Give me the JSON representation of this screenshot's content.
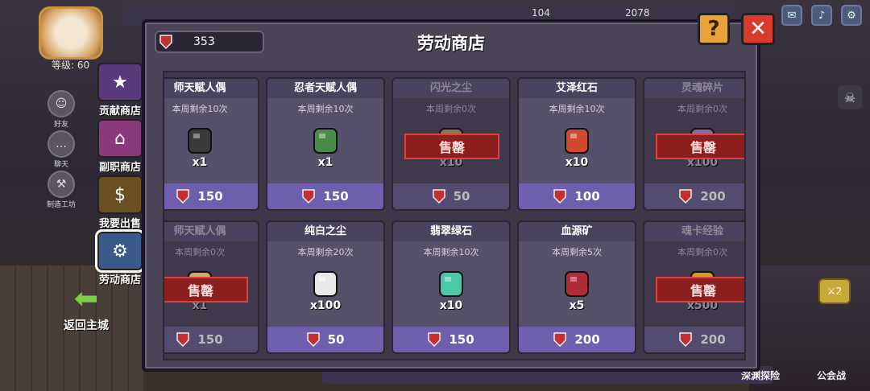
{
  "shop": {
    "title": "劳动商店",
    "currency": "353",
    "help_label": "?",
    "close_label": "✕"
  },
  "player": {
    "level": "等级: 60"
  },
  "top_resources": {
    "res1": "104",
    "res2": "2078"
  },
  "side_menu": [
    {
      "label": "好友",
      "icon": "friend-icon"
    },
    {
      "label": "聊天",
      "icon": "chat-icon"
    },
    {
      "label": "制造工坊",
      "icon": "workshop-icon"
    }
  ],
  "shop_tabs": [
    {
      "label": "贡献商店",
      "color": "#5a3a7a",
      "glyph": "★"
    },
    {
      "label": "副职商店",
      "color": "#8a3a7a",
      "glyph": "⌂"
    },
    {
      "label": "我要出售",
      "color": "#6a5020",
      "glyph": "$"
    },
    {
      "label": "劳动商店",
      "color": "#3a5a8a",
      "glyph": "⚙"
    }
  ],
  "back_label": "返回主城",
  "bottom_labels": {
    "explore": "深渊探险",
    "guild": "公会战"
  },
  "sword_badge": "2",
  "sold_out_label": "售罄",
  "items": [
    {
      "name": "师天赋人偶",
      "limit": "本周剩余10次",
      "qty": "x1",
      "price": "150",
      "sold": false,
      "icon": "mage-doll-icon",
      "color": "#3a3a3a"
    },
    {
      "name": "忍者天赋人偶",
      "limit": "本周剩余10次",
      "qty": "x1",
      "price": "150",
      "sold": false,
      "icon": "ninja-doll-icon",
      "color": "#4a8a4a"
    },
    {
      "name": "闪光之尘",
      "limit": "本周剩余0次",
      "qty": "x10",
      "price": "50",
      "sold": true,
      "icon": "flash-dust-icon",
      "color": "#8a7a5a"
    },
    {
      "name": "艾泽红石",
      "limit": "本周剩余10次",
      "qty": "x10",
      "price": "100",
      "sold": false,
      "icon": "red-stone-icon",
      "color": "#d04a30"
    },
    {
      "name": "灵魂碎片",
      "limit": "本周剩余0次",
      "qty": "x100",
      "price": "200",
      "sold": true,
      "icon": "soul-shard-icon",
      "color": "#8a6aa0"
    },
    {
      "name": "师天赋人偶",
      "limit": "本周剩余0次",
      "qty": "x1",
      "price": "150",
      "sold": true,
      "icon": "mage-doll-icon",
      "color": "#c8b070"
    },
    {
      "name": "纯白之尘",
      "limit": "本周剩余20次",
      "qty": "x100",
      "price": "50",
      "sold": false,
      "icon": "white-dust-icon",
      "color": "#e8e8e8"
    },
    {
      "name": "翡翠绿石",
      "limit": "本周剩余10次",
      "qty": "x10",
      "price": "150",
      "sold": false,
      "icon": "jade-stone-icon",
      "color": "#4ac8a8"
    },
    {
      "name": "血源矿",
      "limit": "本周剩余5次",
      "qty": "x5",
      "price": "200",
      "sold": false,
      "icon": "blood-ore-icon",
      "color": "#b02a3a"
    },
    {
      "name": "魂卡经验",
      "limit": "本周剩余0次",
      "qty": "x500",
      "price": "200",
      "sold": true,
      "icon": "soul-card-exp-icon",
      "color": "#d0a020"
    }
  ]
}
